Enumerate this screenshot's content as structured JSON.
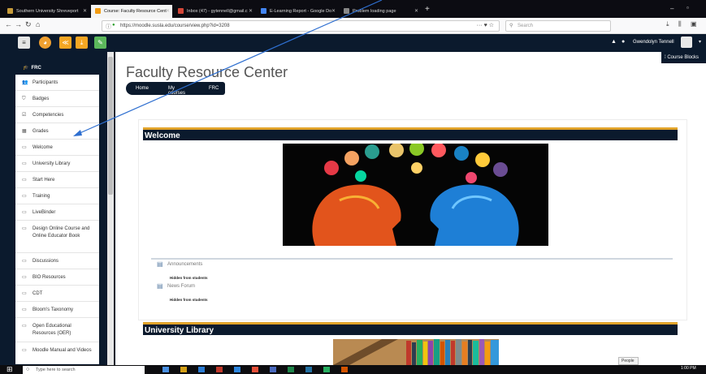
{
  "browser": {
    "tabs": [
      {
        "label": "Southern University Shreveport",
        "color": "#c69b3a"
      },
      {
        "label": "Course: Faculty Resource Cent",
        "color": "#f39c12",
        "active": true
      },
      {
        "label": "Inbox (47) - gytennell@gmail.c",
        "color": "#d44638"
      },
      {
        "label": "E-Learning Report - Google Do",
        "color": "#4285f4"
      },
      {
        "label": "Problem loading page",
        "color": "#888888"
      }
    ],
    "url": "https://moodle.susla.edu/course/view.php?id=3208",
    "search_placeholder": "Search"
  },
  "header": {
    "user_name": "Gwendolyn Tennell"
  },
  "sidebar": {
    "title": "FRC",
    "items": [
      {
        "label": "Participants",
        "icon": "users-icon"
      },
      {
        "label": "Badges",
        "icon": "badge-icon"
      },
      {
        "label": "Competencies",
        "icon": "check-icon"
      },
      {
        "label": "Grades",
        "icon": "table-icon"
      },
      {
        "label": "Welcome",
        "icon": "folder-icon"
      },
      {
        "label": "University Library",
        "icon": "folder-icon"
      },
      {
        "label": "Start Here",
        "icon": "folder-icon"
      },
      {
        "label": "Training",
        "icon": "folder-icon"
      },
      {
        "label": "LiveBinder",
        "icon": "folder-icon"
      },
      {
        "label": "Design Online Course and Online Educator Book",
        "icon": "folder-icon"
      },
      {
        "label": "Discussions",
        "icon": "folder-icon"
      },
      {
        "label": "BIO Resources",
        "icon": "folder-icon"
      },
      {
        "label": "CDT",
        "icon": "folder-icon"
      },
      {
        "label": "Bloom's Taxonomy",
        "icon": "folder-icon"
      },
      {
        "label": "Open Educational Resources (OER)",
        "icon": "folder-icon"
      },
      {
        "label": "Moodle Manual and Videos",
        "icon": "folder-icon"
      }
    ]
  },
  "main": {
    "title": "Faculty Resource Center",
    "breadcrumbs": [
      "Home",
      "My courses",
      "FRC"
    ],
    "course_blocks_label": "Course Blocks",
    "sections": [
      {
        "title": "Welcome"
      },
      {
        "title": "University Library"
      }
    ],
    "activities": [
      {
        "label": "Announcements",
        "note": "Hidden from students"
      },
      {
        "label": "News Forum",
        "note": "Hidden from students"
      }
    ]
  },
  "taskbar": {
    "search_placeholder": "Type here to search",
    "people_label": "People",
    "time": "1:00 PM"
  }
}
